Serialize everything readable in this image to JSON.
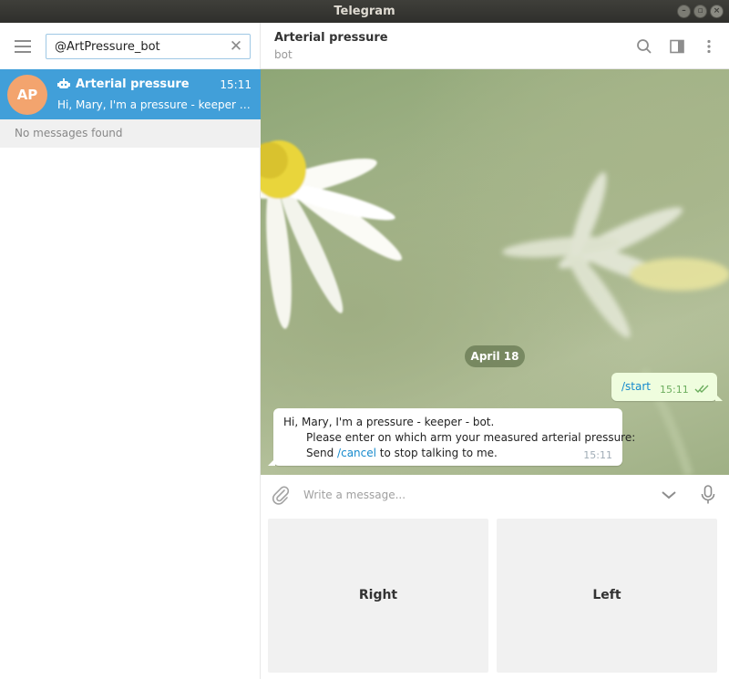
{
  "window": {
    "title": "Telegram"
  },
  "search": {
    "value": "@ArtPressure_bot"
  },
  "dialogs": [
    {
      "avatar_initials": "AP",
      "avatar_color": "#f3a46e",
      "name": "Arterial pressure",
      "time": "15:11",
      "preview": "Hi, Mary, I'm a pressure - keeper - bo...",
      "selected": true
    }
  ],
  "sidebar": {
    "empty_text": "No messages found"
  },
  "header": {
    "title": "Arterial pressure",
    "status": "bot"
  },
  "chat": {
    "date": "April 18",
    "outgoing": {
      "text": "/start",
      "time": "15:11",
      "status": "read"
    },
    "incoming": {
      "line1": "Hi, Mary, I'm a pressure - keeper - bot.",
      "line2": "Please enter on which arm your measured arterial pressure:",
      "line3_before": "Send ",
      "line3_link": "/cancel",
      "line3_after": " to stop talking to me.",
      "time": "15:11"
    }
  },
  "compose": {
    "placeholder": "Write a message..."
  },
  "keyboard": {
    "buttons": [
      "Right",
      "Left"
    ]
  },
  "colors": {
    "accent": "#419fd9",
    "link": "#168acd",
    "outgoing_bubble": "#effdde"
  }
}
